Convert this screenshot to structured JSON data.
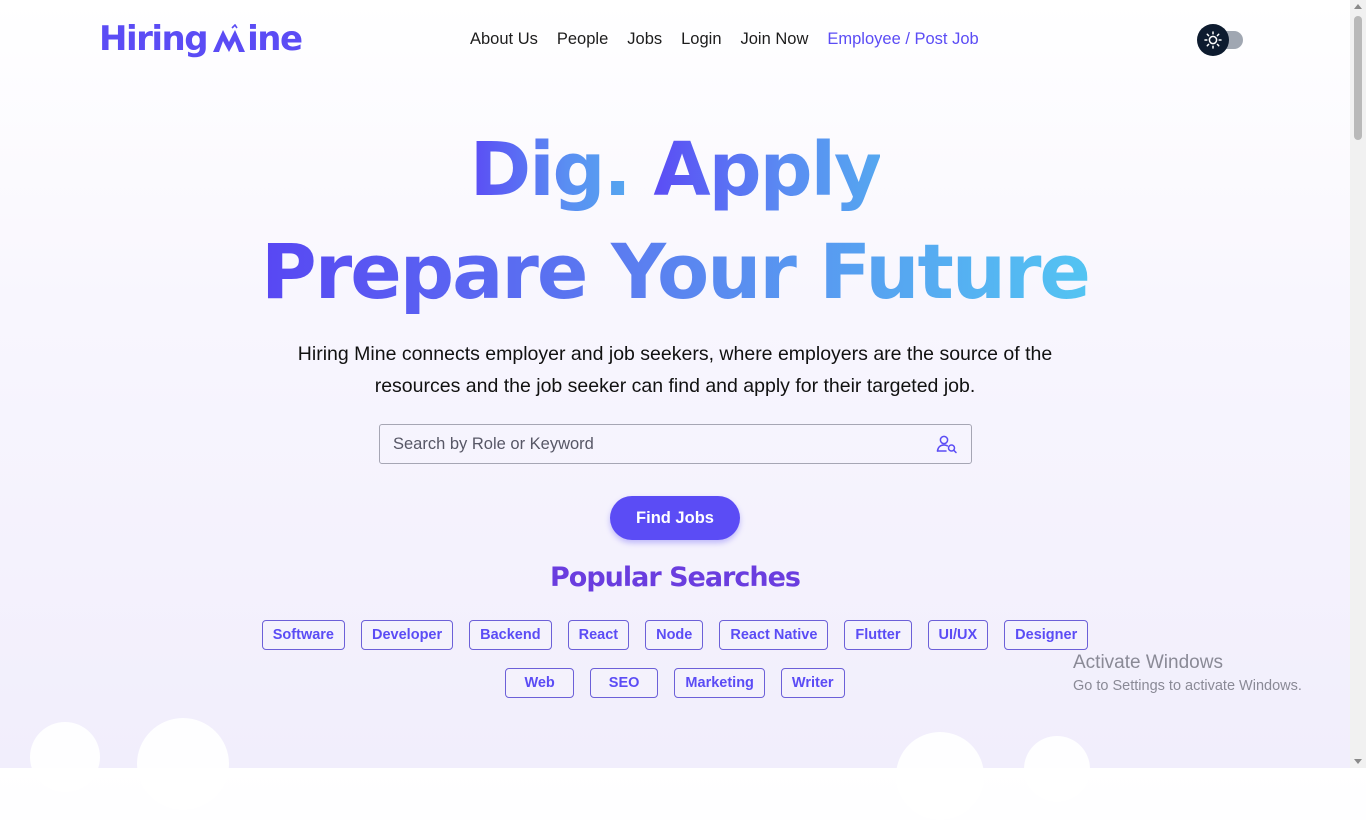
{
  "brand": {
    "name_left": "Hiring",
    "name_right": "ine",
    "logo_icon": "mountain-m-icon",
    "color": "#5b4cf5"
  },
  "nav": {
    "items": [
      "About Us",
      "People",
      "Jobs",
      "Login",
      "Join Now"
    ],
    "cta": "Employee / Post Job",
    "theme_toggle_icon": "sun-icon"
  },
  "hero": {
    "line1": [
      "Dig.",
      "Apply"
    ],
    "line2": [
      "Prepare",
      "Your",
      "Future"
    ],
    "description": "Hiring Mine connects employer and job seekers, where employers are the source of the resources and the job seeker can find and apply for their targeted job."
  },
  "search": {
    "placeholder": "Search by Role or Keyword",
    "value": "",
    "icon": "user-search-icon"
  },
  "find_button": "Find Jobs",
  "popular": {
    "title": "Popular Searches",
    "row1": [
      "Software",
      "Developer",
      "Backend",
      "React",
      "Node",
      "React Native",
      "Flutter",
      "UI/UX",
      "Designer"
    ],
    "row2": [
      "Web",
      "SEO",
      "Marketing",
      "Writer"
    ]
  },
  "watermark": {
    "title": "Activate Windows",
    "subtitle": "Go to Settings to activate Windows."
  },
  "colors": {
    "accent": "#5b4cf5",
    "heading_purple": "#6a3ddf",
    "toggle_dark": "#0d1b2f"
  }
}
